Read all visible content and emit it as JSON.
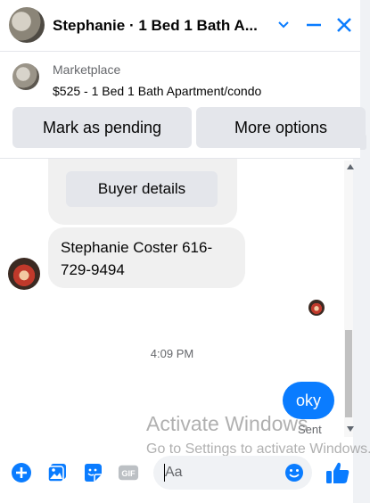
{
  "header": {
    "title": "Stephanie · 1 Bed 1 Bath A...",
    "icons": [
      "chevron-down-icon",
      "minimize-icon",
      "close-icon"
    ]
  },
  "marketplace": {
    "label": "Marketplace",
    "listing": "$525 - 1 Bed 1 Bath Apartment/condo",
    "mark_pending_label": "Mark as pending",
    "more_options_label": "More options"
  },
  "messages": {
    "buyer_details_label": "Buyer details",
    "contact_text": "Stephanie Coster 616-729-9494",
    "timestamp": "4:09 PM",
    "outgoing_text": "oky",
    "status": "Sent"
  },
  "watermark": {
    "line1": "Activate Windows",
    "line2": "Go to Settings to activate Windows."
  },
  "composer": {
    "placeholder": "Aa",
    "tools": [
      "add-icon",
      "photo-icon",
      "sticker-icon",
      "gif-icon"
    ]
  },
  "colors": {
    "accent": "#0a7cff",
    "bubble_gray": "#f0f0f0",
    "button_gray": "#e4e6eb"
  }
}
